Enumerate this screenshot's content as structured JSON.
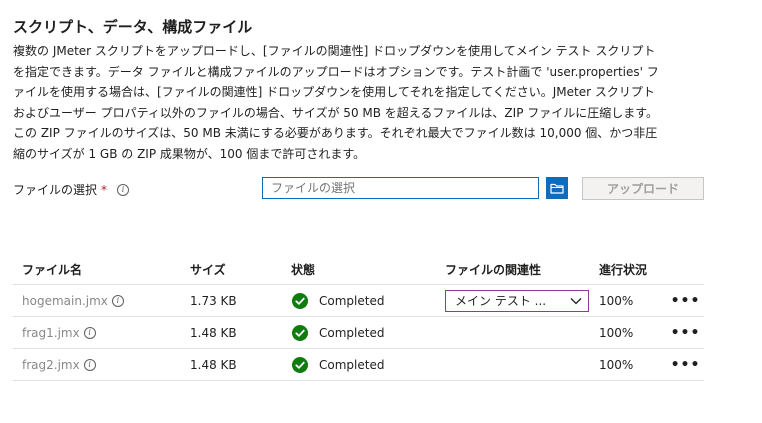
{
  "section": {
    "title": "スクリプト、データ、構成ファイル",
    "description_lines": [
      "複数の JMeter スクリプトをアップロードし、[ファイルの関連性] ドロップダウンを使用してメイン テスト スクリプト",
      "を指定できます。データ ファイルと構成ファイルのアップロードはオプションです。テスト計画で 'user.properties' フ",
      "ァイルを使用する場合は、[ファイルの関連性] ドロップダウンを使用してそれを指定してください。JMeter スクリプト",
      "およびユーザー プロパティ以外のファイルの場合、サイズが 50 MB を超えるファイルは、ZIP ファイルに圧縮します。",
      "この ZIP ファイルのサイズは、50 MB 未満にする必要があります。それぞれ最大でファイル数は 10,000 個、かつ非圧",
      "縮のサイズが 1 GB の ZIP 成果物が、100 個まで許可されます。"
    ]
  },
  "file_select": {
    "label": "ファイルの選択",
    "required_mark": "*",
    "info_glyph": "i",
    "placeholder": "ファイルの選択",
    "value": "",
    "browse_icon": "folder-icon",
    "upload_label": "アップロード",
    "upload_disabled": true
  },
  "table": {
    "headers": [
      "ファイル名",
      "サイズ",
      "状態",
      "ファイルの関連性",
      "進行状況"
    ],
    "rows": [
      {
        "name": "hogemain.jmx",
        "size": "1.73 KB",
        "status": "Completed",
        "relevance": "メイン テスト ...",
        "progress": "100%",
        "more": "•••"
      },
      {
        "name": "frag1.jmx",
        "size": "1.48 KB",
        "status": "Completed",
        "relevance": "",
        "progress": "100%",
        "more": "•••"
      },
      {
        "name": "frag2.jmx",
        "size": "1.48 KB",
        "status": "Completed",
        "relevance": "",
        "progress": "100%",
        "more": "•••"
      }
    ]
  },
  "colors": {
    "accent": "#0f6cbd",
    "success": "#107c10",
    "dropdown_border": "#8a3b9c",
    "required": "#a4262c"
  }
}
